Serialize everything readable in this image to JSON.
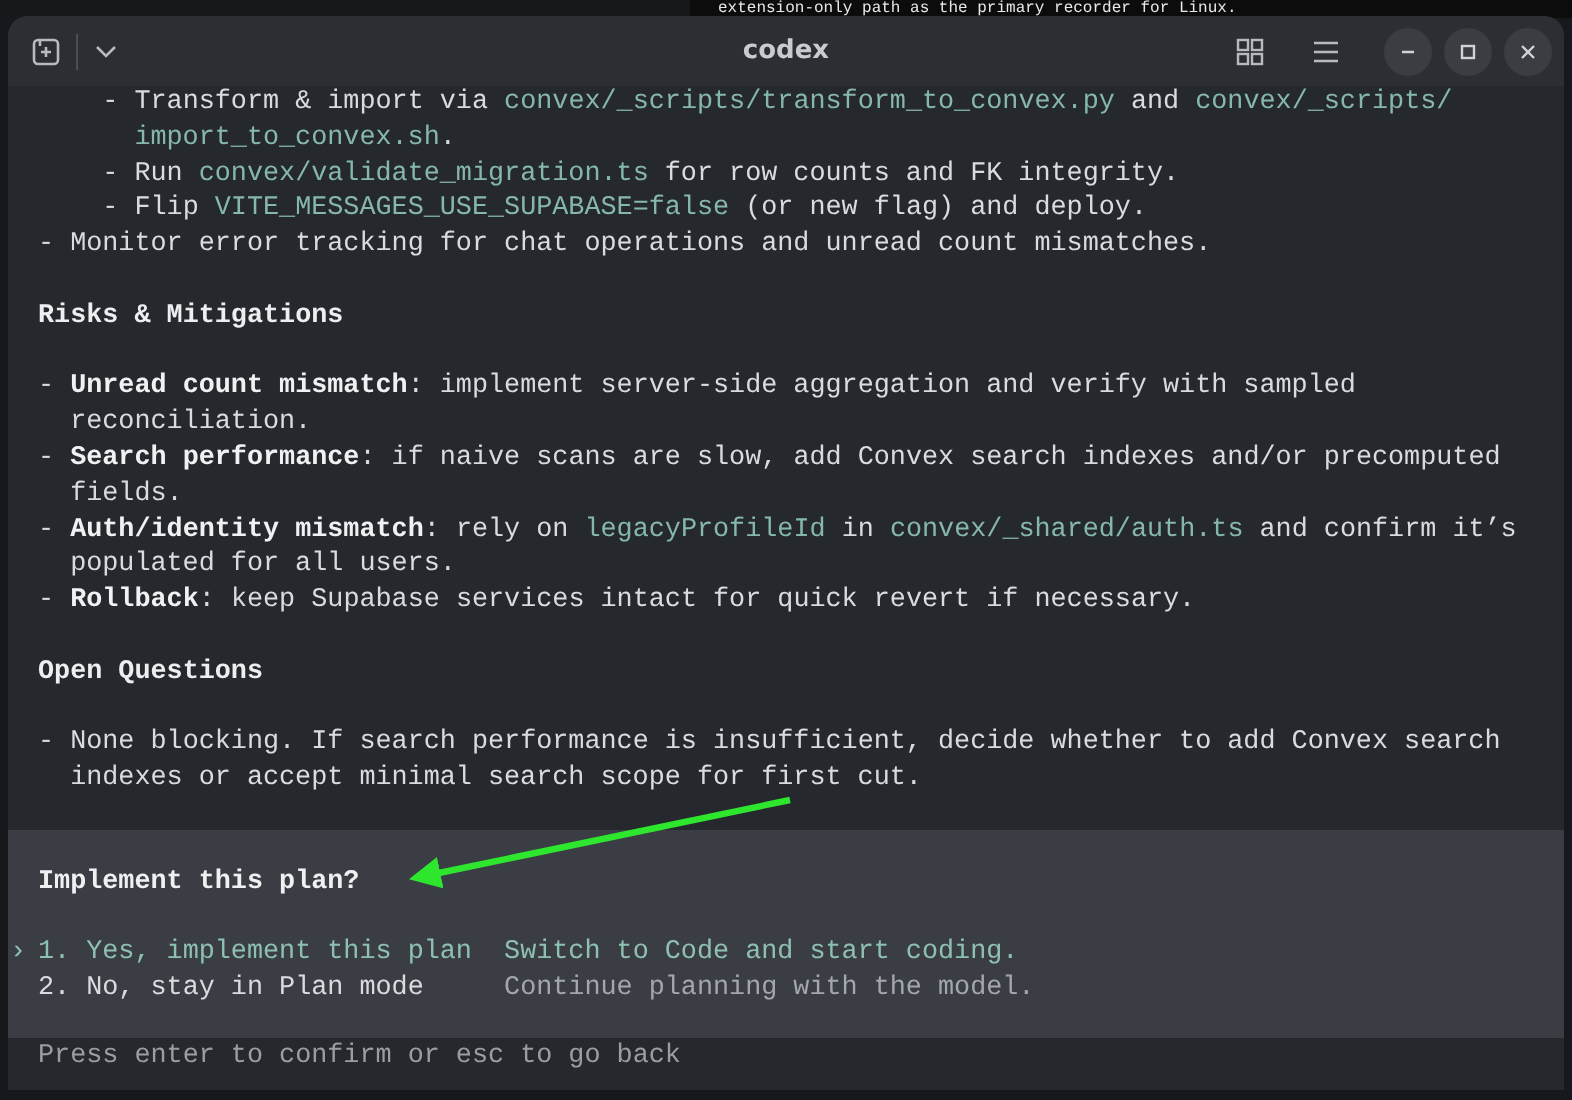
{
  "background_terminal": {
    "text": "extension-only path as the primary recorder for Linux."
  },
  "window": {
    "title": "codex"
  },
  "sections": [
    {
      "items": [
        {
          "children": [
            {
              "segments": [
                {
                  "text": "- Transform & import via ",
                  "kind": "plain"
                },
                {
                  "text": "convex/_scripts/transform_to_convex.py",
                  "kind": "code"
                },
                {
                  "text": " and ",
                  "kind": "plain"
                },
                {
                  "text": "convex/_scripts/import_to_convex.sh",
                  "kind": "code"
                },
                {
                  "text": ".",
                  "kind": "plain"
                }
              ]
            },
            {
              "segments": [
                {
                  "text": "- Run ",
                  "kind": "plain"
                },
                {
                  "text": "convex/validate_migration.ts",
                  "kind": "code"
                },
                {
                  "text": " for row counts and FK integrity.",
                  "kind": "plain"
                }
              ]
            },
            {
              "segments": [
                {
                  "text": "- Flip ",
                  "kind": "plain"
                },
                {
                  "text": "VITE_MESSAGES_USE_SUPABASE=false",
                  "kind": "code"
                },
                {
                  "text": " (or new flag) and deploy.",
                  "kind": "plain"
                }
              ]
            }
          ]
        },
        {
          "segments": [
            {
              "text": "- Monitor error tracking for chat operations and unread count mismatches.",
              "kind": "plain"
            }
          ]
        }
      ]
    },
    {
      "heading": "Risks & Mitigations",
      "items": [
        {
          "segments": [
            {
              "text": "- ",
              "kind": "plain"
            },
            {
              "text": "Unread count mismatch",
              "kind": "bold"
            },
            {
              "text": ": implement server-side aggregation and verify with sampled reconciliation.",
              "kind": "plain"
            }
          ]
        },
        {
          "segments": [
            {
              "text": "- ",
              "kind": "plain"
            },
            {
              "text": "Search performance",
              "kind": "bold"
            },
            {
              "text": ": if naive scans are slow, add Convex search indexes and/or precomputed fields.",
              "kind": "plain"
            }
          ]
        },
        {
          "segments": [
            {
              "text": "- ",
              "kind": "plain"
            },
            {
              "text": "Auth/identity mismatch",
              "kind": "bold"
            },
            {
              "text": ": rely on ",
              "kind": "plain"
            },
            {
              "text": "legacyProfileId",
              "kind": "code"
            },
            {
              "text": " in ",
              "kind": "plain"
            },
            {
              "text": "convex/_shared/auth.ts",
              "kind": "code"
            },
            {
              "text": " and confirm it’s populated for all users.",
              "kind": "plain"
            }
          ]
        },
        {
          "segments": [
            {
              "text": "- ",
              "kind": "plain"
            },
            {
              "text": "Rollback",
              "kind": "bold"
            },
            {
              "text": ": keep Supabase services intact for quick revert if necessary.",
              "kind": "plain"
            }
          ]
        }
      ]
    },
    {
      "heading": "Open Questions",
      "items": [
        {
          "segments": [
            {
              "text": "- None blocking. If search performance is insufficient, decide whether to add Convex search indexes or accept minimal search scope for first cut.",
              "kind": "plain"
            }
          ]
        }
      ]
    }
  ],
  "prompt": {
    "question": "Implement this plan?",
    "pointer": "›",
    "options": [
      {
        "label": "1. Yes, implement this plan",
        "description": "Switch to Code and start coding.",
        "selected": true
      },
      {
        "label": "2. No, stay in Plan mode",
        "description": "Continue planning with the model.",
        "selected": false
      }
    ],
    "hint": "Press enter to confirm or esc to go back"
  }
}
